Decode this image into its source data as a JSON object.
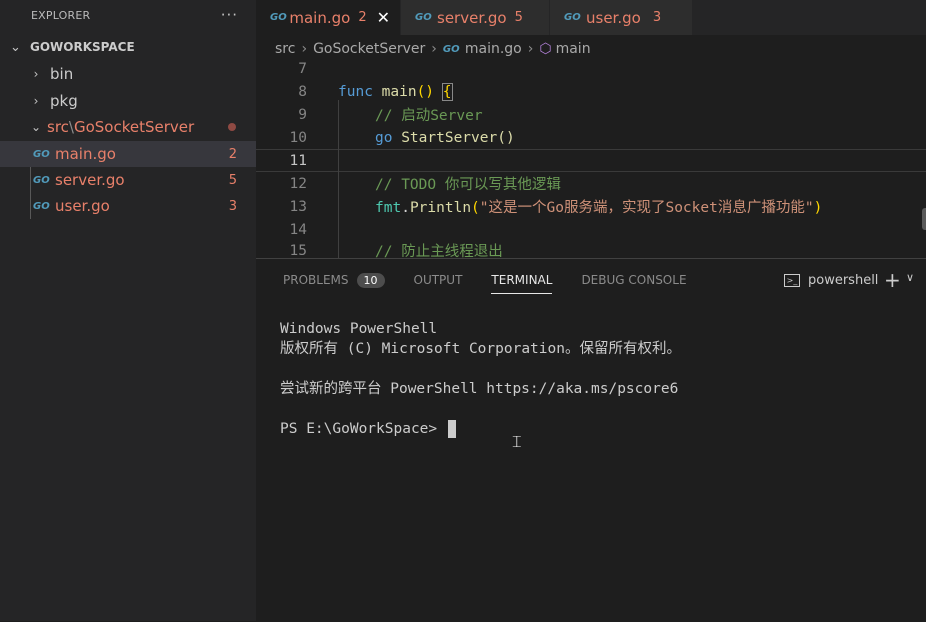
{
  "sidebar": {
    "title": "EXPLORER",
    "more": "···",
    "workspace": "GOWORKSPACE",
    "folders": [
      {
        "label": "bin"
      },
      {
        "label": "pkg"
      }
    ],
    "open_folder": {
      "part1": "src",
      "sep": "\\",
      "part2": "GoSocketServer"
    },
    "files": [
      {
        "label": "main.go",
        "errors": "2"
      },
      {
        "label": "server.go",
        "errors": "5"
      },
      {
        "label": "user.go",
        "errors": "3"
      }
    ],
    "go_icon": "GO"
  },
  "tabs": [
    {
      "label": "main.go",
      "errors": "2",
      "close": "✕"
    },
    {
      "label": "server.go",
      "errors": "5"
    },
    {
      "label": "user.go",
      "errors": "3"
    }
  ],
  "breadcrumb": {
    "a": "src",
    "b": "GoSocketServer",
    "c": "main.go",
    "d": "main"
  },
  "editor": {
    "lines": [
      "7",
      "8",
      "9",
      "10",
      "11",
      "12",
      "13",
      "14",
      "15"
    ],
    "code": {
      "l8_kw": "func",
      "l8_fn": "main",
      "l8_paren": "()",
      "l8_brace": "{",
      "l9": "// 启动Server",
      "l10_kw": "go",
      "l10_fn": "StartServer",
      "l10_paren": "()",
      "l12": "// TODO 你可以写其他逻辑",
      "l13_pkg": "fmt",
      "l13_dot": ".",
      "l13_fn": "Println",
      "l13_open": "(",
      "l13_str": "\"这是一个Go服务端，实现了Socket消息广播功能\"",
      "l13_close": ")",
      "l15": "// 防止主线程退出"
    }
  },
  "panel": {
    "tabs": {
      "problems": "PROBLEMS",
      "problems_count": "10",
      "output": "OUTPUT",
      "terminal": "TERMINAL",
      "debug": "DEBUG CONSOLE"
    },
    "shell": "powershell",
    "shell_icon": ">_",
    "plus": "+",
    "chevron": "∨"
  },
  "terminal": {
    "line1": "Windows PowerShell",
    "line2": "版权所有 (C) Microsoft Corporation。保留所有权利。",
    "line3": "尝试新的跨平台 PowerShell https://aka.ms/pscore6",
    "prompt": "PS E:\\GoWorkSpace> "
  }
}
